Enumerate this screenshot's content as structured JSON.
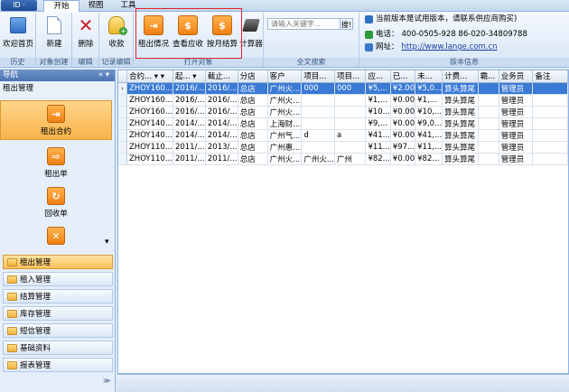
{
  "app_button": "ID ·",
  "tabs": [
    {
      "label": "开始"
    },
    {
      "label": "视图"
    },
    {
      "label": "工具"
    }
  ],
  "ribbon": {
    "buttons": {
      "welcome": "欢迎首页",
      "new": "新建",
      "delete": "删除",
      "collect": "收款",
      "rent_status": "租出情况",
      "view_receivable": "查看应收",
      "monthly_settle": "按月结算",
      "calculator": "计算器"
    },
    "groups": {
      "history": "历史",
      "object_create": "对象创建",
      "edit": "编辑",
      "record_edit": "记录编辑",
      "open_object": "打开对象",
      "fulltext": "全文搜索",
      "version": "版本信息"
    },
    "search": {
      "placeholder": "请输入关键字...",
      "button": "搜!"
    },
    "info": {
      "notice": "当前版本是试用版本，请联系供应商购买)",
      "phone_label": "电话：",
      "phone": "400-0505-928  86-020-34809788",
      "web_label": "网址：",
      "web": "http://www.lange.com.cn"
    }
  },
  "nav": {
    "title": "导航",
    "pin": "« ▾",
    "section": "租出管理",
    "big_items": [
      {
        "label": "租出合约",
        "glyph": "⇥"
      },
      {
        "label": "租出单",
        "glyph": "⇨"
      },
      {
        "label": "回收单",
        "glyph": "↻"
      },
      {
        "label": "",
        "glyph": "✕"
      }
    ],
    "scroll_down": "▾",
    "categories": [
      {
        "label": "租出管理"
      },
      {
        "label": "租入管理"
      },
      {
        "label": "结算管理"
      },
      {
        "label": "库存管理"
      },
      {
        "label": "短信管理"
      },
      {
        "label": "基础资料"
      },
      {
        "label": "报表管理"
      }
    ],
    "bottom": "≫"
  },
  "grid": {
    "columns": [
      "合约... ▾ ▾",
      "起... ▾",
      "截止...",
      "分店",
      "客户",
      "项目...",
      "项目...",
      "应...",
      "已...",
      "未...",
      "计费...",
      "霸...",
      "业务员",
      "备注"
    ],
    "rows": [
      {
        "indicator": "›",
        "cells": [
          "ZHOY160...",
          "2016/...",
          "2016/...",
          "总店",
          "广州火...",
          "000",
          "000",
          "¥5,...",
          "¥2.00",
          "¥5,0...",
          "算头算尾",
          "",
          "管理员",
          ""
        ]
      },
      {
        "indicator": "",
        "cells": [
          "ZHOY160...",
          "2016/...",
          "2016/...",
          "总店",
          "广州火...",
          "",
          "",
          "¥1,...",
          "¥0.00",
          "¥1,...",
          "算头算尾",
          "",
          "管理员",
          ""
        ]
      },
      {
        "indicator": "",
        "cells": [
          "ZHOY160...",
          "2016/...",
          "2016/...",
          "总店",
          "广州火...",
          "",
          "",
          "¥10...",
          "¥0.00",
          "¥10,...",
          "算头算尾",
          "",
          "管理员",
          ""
        ]
      },
      {
        "indicator": "",
        "cells": [
          "ZHOY140...",
          "2014/...",
          "2014/...",
          "总店",
          "上海财...",
          "",
          "",
          "¥9,...",
          "¥0.00",
          "¥9,0...",
          "算头算尾",
          "",
          "管理员",
          ""
        ]
      },
      {
        "indicator": "",
        "cells": [
          "ZHOY140...",
          "2014/...",
          "2014/...",
          "总店",
          "广州气...",
          "d",
          "a",
          "¥41...",
          "¥0.00",
          "¥41,...",
          "算头算尾",
          "",
          "管理员",
          ""
        ]
      },
      {
        "indicator": "",
        "cells": [
          "ZHOY110...",
          "2011/...",
          "2013/...",
          "总店",
          "广州惠...",
          "",
          "",
          "¥11...",
          "¥97...",
          "¥11,...",
          "算头算尾",
          "",
          "管理员",
          ""
        ]
      },
      {
        "indicator": "",
        "cells": [
          "ZHOY110...",
          "2011/...",
          "2011/...",
          "总店",
          "广州火...",
          "广州火...",
          "广州",
          "¥82...",
          "¥0.00",
          "¥82...",
          "算头算尾",
          "",
          "管理员",
          ""
        ]
      }
    ]
  },
  "colors": {
    "accent": "#3a7ad5",
    "highlight": "#e2232a",
    "orange": "#f07f12"
  }
}
